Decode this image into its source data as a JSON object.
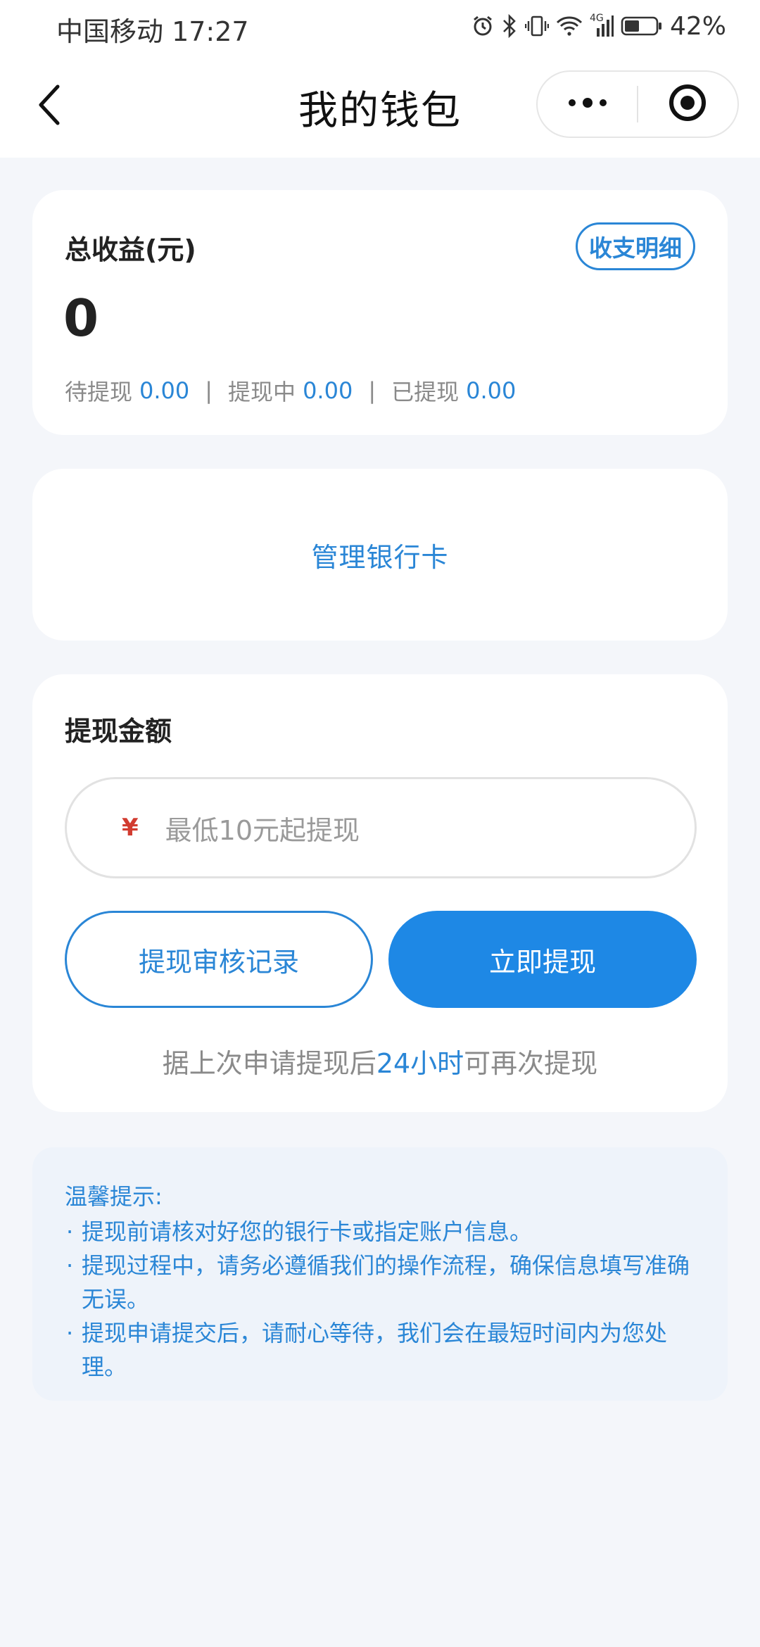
{
  "status_bar": {
    "carrier_time": "中国移动 17:27",
    "network": "4G",
    "battery": "42%"
  },
  "nav": {
    "title": "我的钱包"
  },
  "earnings": {
    "label": "总收益(元)",
    "detail_button": "收支明细",
    "total": "0",
    "pending_label": "待提现",
    "pending_value": "0.00",
    "processing_label": "提现中",
    "processing_value": "0.00",
    "withdrawn_label": "已提现",
    "withdrawn_value": "0.00",
    "separator": "|"
  },
  "bank": {
    "manage_label": "管理银行卡"
  },
  "withdraw": {
    "label": "提现金额",
    "currency_symbol": "¥",
    "placeholder": "最低10元起提现",
    "records_button": "提现审核记录",
    "submit_button": "立即提现",
    "note_prefix": "据上次申请提现后",
    "note_highlight": "24小时",
    "note_suffix": "可再次提现"
  },
  "tips": {
    "title": "温馨提示:",
    "items": [
      "提现前请核对好您的银行卡或指定账户信息。",
      "提现过程中，请务必遵循我们的操作流程，确保信息填写准确无误。",
      "提现申请提交后，请耐心等待，我们会在最短时间内为您处理。"
    ]
  },
  "colors": {
    "accent": "#1e88e5",
    "link": "#2a86d6",
    "background": "#f4f6fa",
    "yen": "#d23c30"
  },
  "icons": {
    "back": "chevron-left-icon",
    "more": "more-dots-icon",
    "close": "target-circle-icon",
    "alarm": "alarm-icon",
    "bluetooth": "bluetooth-icon",
    "vibrate": "vibrate-icon",
    "wifi": "wifi-icon",
    "signal": "signal-icon",
    "battery": "battery-icon"
  }
}
